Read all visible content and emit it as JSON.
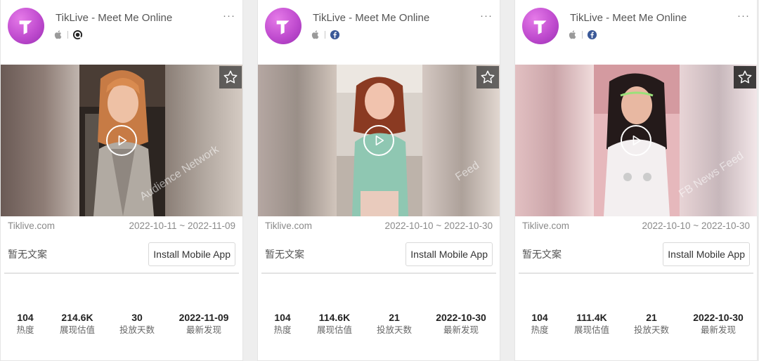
{
  "cards": [
    {
      "app_title": "TikLive - Meet Me Online",
      "platform_icons": [
        "apple-icon",
        "audience-network-icon"
      ],
      "media": {
        "watermark": "Audience Network",
        "left_blur": [
          "#6a5a55",
          "#8e7d76",
          "#c0b5ae"
        ],
        "right_blur": [
          "#8a7e76",
          "#b2a8a0",
          "#d6ccc4"
        ]
      },
      "domain": "Tiklive.com",
      "date_range": "2022-10-11 ~ 2022-11-09",
      "copy_text": "暂无文案",
      "cta_label": "Install Mobile App",
      "stats": [
        {
          "value": "104",
          "label": "热度"
        },
        {
          "value": "214.6K",
          "label": "展现估值"
        },
        {
          "value": "30",
          "label": "投放天数"
        },
        {
          "value": "2022-11-09",
          "label": "最新发现"
        }
      ]
    },
    {
      "app_title": "TikLive - Meet Me Online",
      "platform_icons": [
        "apple-icon",
        "facebook-icon"
      ],
      "media": {
        "watermark": "Feed",
        "left_blur": [
          "#b5a7a2",
          "#9a8f88",
          "#d1c5bc"
        ],
        "right_blur": [
          "#d4c8c2",
          "#ada19a",
          "#e3d9d2"
        ]
      },
      "domain": "Tiklive.com",
      "date_range": "2022-10-10 ~ 2022-10-30",
      "copy_text": "暂无文案",
      "cta_label": "Install Mobile App",
      "stats": [
        {
          "value": "104",
          "label": "热度"
        },
        {
          "value": "114.6K",
          "label": "展现估值"
        },
        {
          "value": "21",
          "label": "投放天数"
        },
        {
          "value": "2022-10-30",
          "label": "最新发现"
        }
      ]
    },
    {
      "app_title": "TikLive - Meet Me Online",
      "platform_icons": [
        "apple-icon",
        "facebook-icon"
      ],
      "media": {
        "watermark": "FB News Feed",
        "left_blur": [
          "#e2c0c2",
          "#caa4a8",
          "#f0dcdc"
        ],
        "right_blur": [
          "#e8d4d6",
          "#c7b7bb",
          "#f4e8ea"
        ]
      },
      "domain": "Tiklive.com",
      "date_range": "2022-10-10 ~ 2022-10-30",
      "copy_text": "暂无文案",
      "cta_label": "Install Mobile App",
      "stats": [
        {
          "value": "104",
          "label": "热度"
        },
        {
          "value": "111.4K",
          "label": "展现估值"
        },
        {
          "value": "21",
          "label": "投放天数"
        },
        {
          "value": "2022-10-30",
          "label": "最新发现"
        }
      ]
    }
  ]
}
